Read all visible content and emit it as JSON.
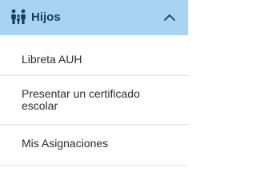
{
  "header": {
    "title": "Hijos",
    "icon": "family-icon",
    "toggle_icon": "chevron-up-icon",
    "background_color": "#a8d4f2",
    "text_color": "#1a3d5c"
  },
  "items": [
    {
      "label": "Libreta AUH"
    },
    {
      "label": "Presentar un certificado escolar"
    },
    {
      "label": "Mis Asignaciones"
    }
  ]
}
